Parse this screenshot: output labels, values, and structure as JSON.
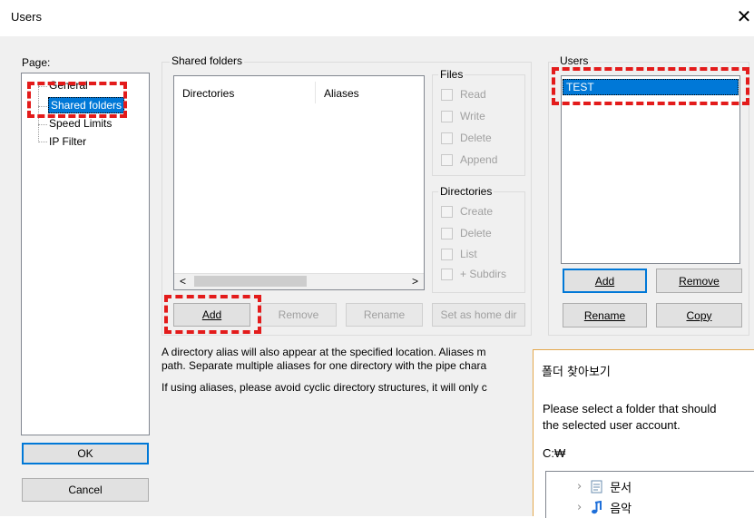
{
  "window": {
    "title": "Users",
    "close_glyph": "✕"
  },
  "page_panel": {
    "label": "Page:",
    "items": [
      {
        "label": "General"
      },
      {
        "label": "Shared folders"
      },
      {
        "label": "Speed Limits"
      },
      {
        "label": "IP Filter"
      }
    ]
  },
  "shared_folders": {
    "group_label": "Shared folders",
    "columns": [
      "Directories",
      "Aliases"
    ],
    "scroll_left": "<",
    "scroll_right": ">",
    "buttons": {
      "add": "Add",
      "remove": "Remove",
      "rename": "Rename",
      "home": "Set as home dir"
    }
  },
  "files": {
    "label": "Files",
    "items": [
      "Read",
      "Write",
      "Delete",
      "Append"
    ]
  },
  "directories": {
    "label": "Directories",
    "items": [
      "Create",
      "Delete",
      "List",
      "+ Subdirs"
    ]
  },
  "users": {
    "group_label": "Users",
    "selected": "TEST",
    "buttons": {
      "add": "Add",
      "remove": "Remove",
      "rename": "Rename",
      "copy": "Copy"
    }
  },
  "description": {
    "line1": "A directory alias will also appear at the specified location. Aliases m",
    "line2": "path. Separate multiple aliases for one directory with the pipe chara",
    "line3": "If using aliases, please avoid cyclic directory structures, it will only c"
  },
  "dialog_buttons": {
    "ok": "OK",
    "cancel": "Cancel"
  },
  "folder_browser": {
    "title": "폴더 찾아보기",
    "message_line1": "Please select a folder that should",
    "message_line2": "the selected user account.",
    "path": "C:₩",
    "items": [
      {
        "label": "문서",
        "icon": "document-icon"
      },
      {
        "label": "음악",
        "icon": "music-icon"
      }
    ]
  },
  "colors": {
    "accent": "#0078d7",
    "highlight_box": "#e31b1b",
    "overlay_border": "#e4a84d"
  }
}
